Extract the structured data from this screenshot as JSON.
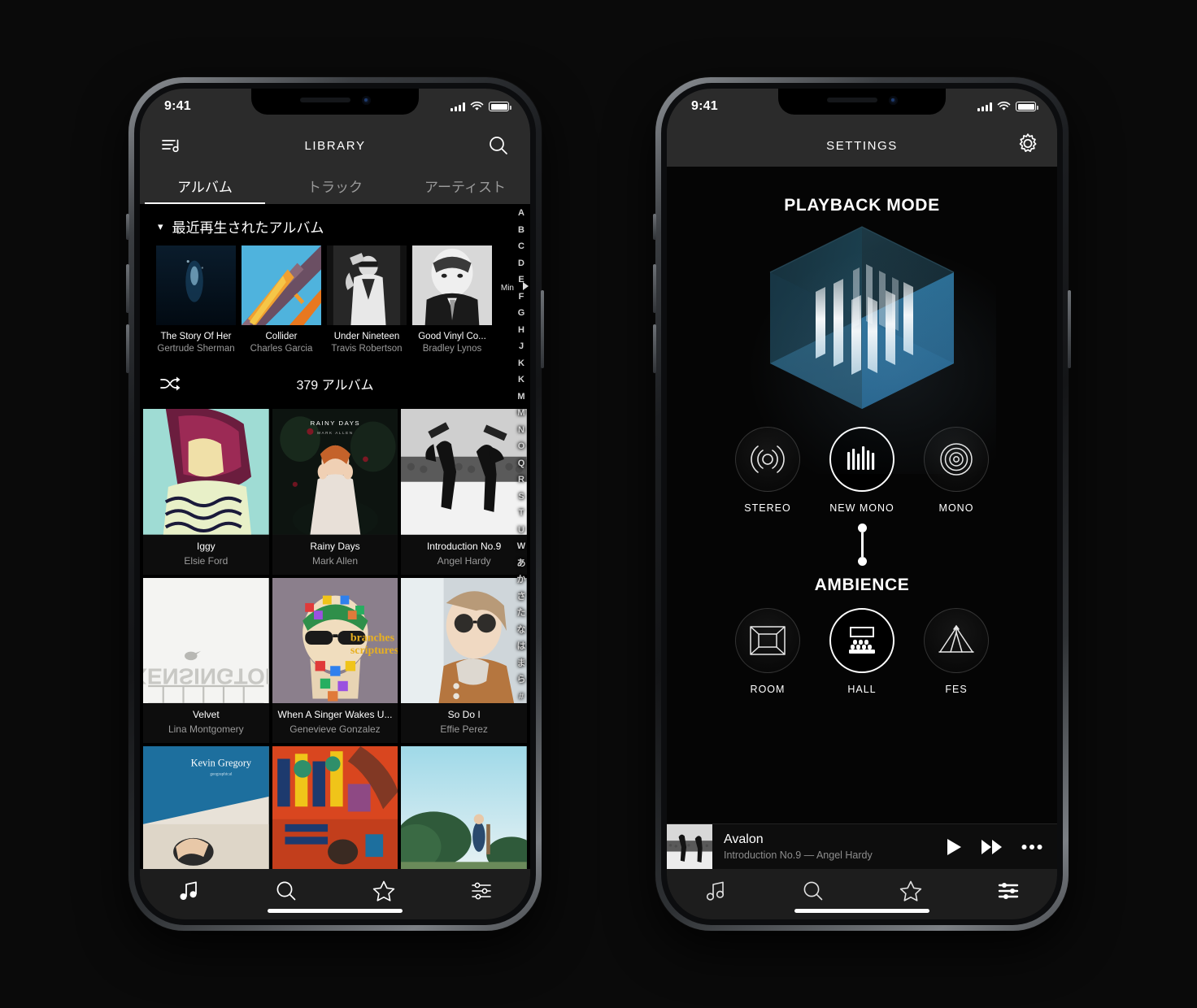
{
  "left_phone": {
    "status_bar": {
      "time": "9:41",
      "signal_icon": "cellular-bars-icon",
      "wifi_icon": "wifi-icon",
      "battery_icon": "battery-icon"
    },
    "navbar": {
      "menu_icon": "playlist-music-icon",
      "title": "LIBRARY",
      "search_icon": "search-icon"
    },
    "tabs": [
      {
        "label": "アルバム",
        "active": true
      },
      {
        "label": "トラック",
        "active": false
      },
      {
        "label": "アーティスト",
        "active": false
      }
    ],
    "recent_section": {
      "chevron_icon": "chevron-down-icon",
      "title": "最近再生されたアルバム"
    },
    "recent_albums": [
      {
        "title": "The Story Of Her",
        "artist": "Gertrude Sherman"
      },
      {
        "title": "Collider",
        "artist": "Charles Garcia"
      },
      {
        "title": "Under Nineteen",
        "artist": "Travis Robertson"
      },
      {
        "title": "Good Vinyl Co...",
        "artist": "Bradley Lynos"
      }
    ],
    "shuffle": {
      "icon": "shuffle-icon",
      "count_label": "379 アルバム"
    },
    "albums": [
      {
        "title": "Iggy",
        "artist": "Elsie Ford"
      },
      {
        "title": "Rainy Days",
        "artist": "Mark Allen"
      },
      {
        "title": "Introduction No.9",
        "artist": "Angel Hardy"
      },
      {
        "title": "Velvet",
        "artist": "Lina Montgomery"
      },
      {
        "title": "When A Singer Wakes U...",
        "artist": "Genevieve Gonzalez"
      },
      {
        "title": "So Do I",
        "artist": "Effie Perez"
      }
    ],
    "index_scrubber": {
      "letters": [
        "A",
        "B",
        "C",
        "D",
        "E",
        "F",
        "G",
        "H",
        "J",
        "K",
        "K",
        "M",
        "M",
        "N",
        "O",
        "Q",
        "R",
        "S",
        "T",
        "U",
        "W",
        "あ",
        "か",
        "さ",
        "た",
        "な",
        "は",
        "ま",
        "ら",
        "#"
      ],
      "marker_label": "Min",
      "marker_icon": "play-triangle-icon"
    },
    "tabbar": [
      {
        "name": "music",
        "icon": "music-note-icon",
        "active": true
      },
      {
        "name": "search",
        "icon": "search-icon",
        "active": false
      },
      {
        "name": "favorites",
        "icon": "star-icon",
        "active": false
      },
      {
        "name": "settings",
        "icon": "sliders-icon",
        "active": false
      }
    ]
  },
  "right_phone": {
    "status_bar": {
      "time": "9:41",
      "signal_icon": "cellular-bars-icon",
      "wifi_icon": "wifi-icon",
      "battery_icon": "battery-icon"
    },
    "navbar": {
      "title": "SETTINGS",
      "gear_icon": "gear-icon"
    },
    "playback_mode": {
      "title": "PLAYBACK MODE",
      "hero_icon": "isometric-cube-bars-icon",
      "options": [
        {
          "label": "STEREO",
          "icon": "stereo-waves-icon",
          "selected": false
        },
        {
          "label": "NEW MONO",
          "icon": "mono-bars-icon",
          "selected": true
        },
        {
          "label": "MONO",
          "icon": "concentric-circles-icon",
          "selected": false
        }
      ]
    },
    "ambience": {
      "title": "AMBIENCE",
      "options": [
        {
          "label": "ROOM",
          "icon": "room-box-icon",
          "selected": false
        },
        {
          "label": "HALL",
          "icon": "hall-seats-icon",
          "selected": true
        },
        {
          "label": "FES",
          "icon": "tent-icon",
          "selected": false
        }
      ]
    },
    "now_playing": {
      "title": "Avalon",
      "subtitle": "Introduction No.9 — Angel Hardy",
      "play_icon": "play-icon",
      "next_icon": "fast-forward-icon",
      "more_icon": "more-dots-icon"
    },
    "tabbar": [
      {
        "name": "music",
        "icon": "music-note-icon",
        "active": false
      },
      {
        "name": "search",
        "icon": "search-icon",
        "active": false
      },
      {
        "name": "favorites",
        "icon": "star-icon",
        "active": false
      },
      {
        "name": "settings",
        "icon": "sliders-icon",
        "active": true
      }
    ]
  },
  "colors": {
    "background": "#0a0a0a",
    "nav_bg": "#2b2b2b",
    "tabbar_bg": "#1d1d1d",
    "accent_cube_top": "#16272f",
    "accent_cube_right": "#2a6d93",
    "accent_cube_floor": "#3e87ae",
    "text_primary": "#ffffff",
    "text_secondary": "#9b9b9b"
  }
}
